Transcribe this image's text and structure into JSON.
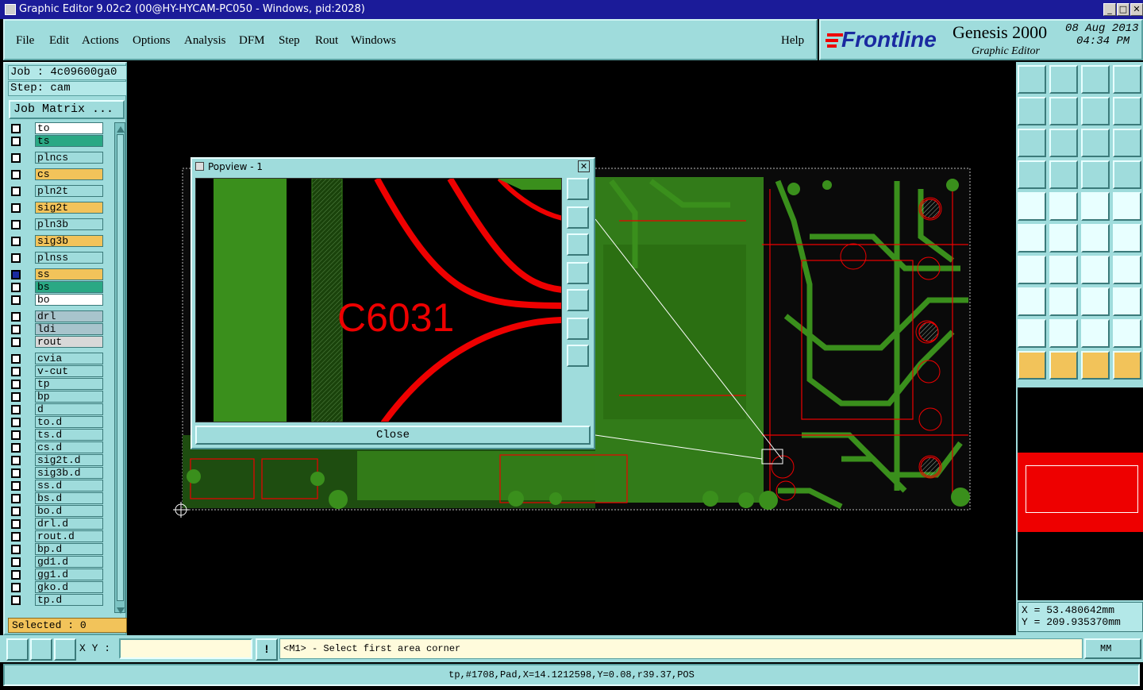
{
  "window": {
    "title": "Graphic Editor 9.02c2 (00@HY-HYCAM-PC050 - Windows, pid:2028)"
  },
  "menu": {
    "items": [
      "File",
      "Edit",
      "Actions",
      "Options",
      "Analysis",
      "DFM",
      "Step",
      "Rout",
      "Windows"
    ],
    "help": "Help"
  },
  "brand": {
    "logo": "Frontline",
    "product": "Genesis 2000",
    "subtitle": "Graphic Editor",
    "date": "08 Aug 2013",
    "time": "04:34 PM"
  },
  "left": {
    "job": "Job : 4c09600ga0",
    "step": "Step: cam",
    "job_matrix": "Job Matrix ...",
    "selected": "Selected : 0"
  },
  "layers": [
    {
      "name": "to",
      "color": "#ffffff"
    },
    {
      "name": "ts",
      "color": "#2aa884"
    },
    {
      "name": "plncs",
      "color": "#9fdcdc"
    },
    {
      "name": "cs",
      "color": "#f2c35a"
    },
    {
      "name": "pln2t",
      "color": "#9fdcdc"
    },
    {
      "name": "sig2t",
      "color": "#f2c35a"
    },
    {
      "name": "pln3b",
      "color": "#9fdcdc"
    },
    {
      "name": "sig3b",
      "color": "#f2c35a"
    },
    {
      "name": "plnss",
      "color": "#9fdcdc"
    },
    {
      "name": "ss",
      "color": "#f2c35a"
    },
    {
      "name": "bs",
      "color": "#2aa884"
    },
    {
      "name": "bo",
      "color": "#ffffff"
    },
    {
      "name": "drl",
      "color": "#a8c4cc"
    },
    {
      "name": "ldi",
      "color": "#a8c4cc"
    },
    {
      "name": "rout",
      "color": "#d8d8d8"
    },
    {
      "name": "cvia",
      "color": "#9fdcdc"
    },
    {
      "name": "v-cut",
      "color": "#9fdcdc"
    },
    {
      "name": "tp",
      "color": "#9fdcdc"
    },
    {
      "name": "bp",
      "color": "#9fdcdc"
    },
    {
      "name": "d",
      "color": "#9fdcdc"
    },
    {
      "name": "to.d",
      "color": "#9fdcdc"
    },
    {
      "name": "ts.d",
      "color": "#9fdcdc"
    },
    {
      "name": "cs.d",
      "color": "#9fdcdc"
    },
    {
      "name": "sig2t.d",
      "color": "#9fdcdc"
    },
    {
      "name": "sig3b.d",
      "color": "#9fdcdc"
    },
    {
      "name": "ss.d",
      "color": "#9fdcdc"
    },
    {
      "name": "bs.d",
      "color": "#9fdcdc"
    },
    {
      "name": "bo.d",
      "color": "#9fdcdc"
    },
    {
      "name": "drl.d",
      "color": "#9fdcdc"
    },
    {
      "name": "rout.d",
      "color": "#9fdcdc"
    },
    {
      "name": "bp.d",
      "color": "#9fdcdc"
    },
    {
      "name": "gd1.d",
      "color": "#9fdcdc"
    },
    {
      "name": "gg1.d",
      "color": "#9fdcdc"
    },
    {
      "name": "gko.d",
      "color": "#9fdcdc"
    },
    {
      "name": "tp.d",
      "color": "#9fdcdc"
    }
  ],
  "popview": {
    "title": "Popview - 1",
    "label": "C6031",
    "close": "Close"
  },
  "coords": {
    "x": "X = 53.480642mm",
    "y": "Y = 209.935370mm"
  },
  "bottom": {
    "xy_label": "X Y :",
    "xy_value": "",
    "prompt": "<M1> - Select first area corner",
    "units": "MM",
    "status": "tp,#1708,Pad,X=14.1212598,Y=0.08,r39.37,POS"
  },
  "colors": {
    "panel": "#9fdcdc",
    "pcb_green": "#3a8f1c",
    "pcb_red": "#ff0000",
    "highlight": "#f2c35a"
  }
}
